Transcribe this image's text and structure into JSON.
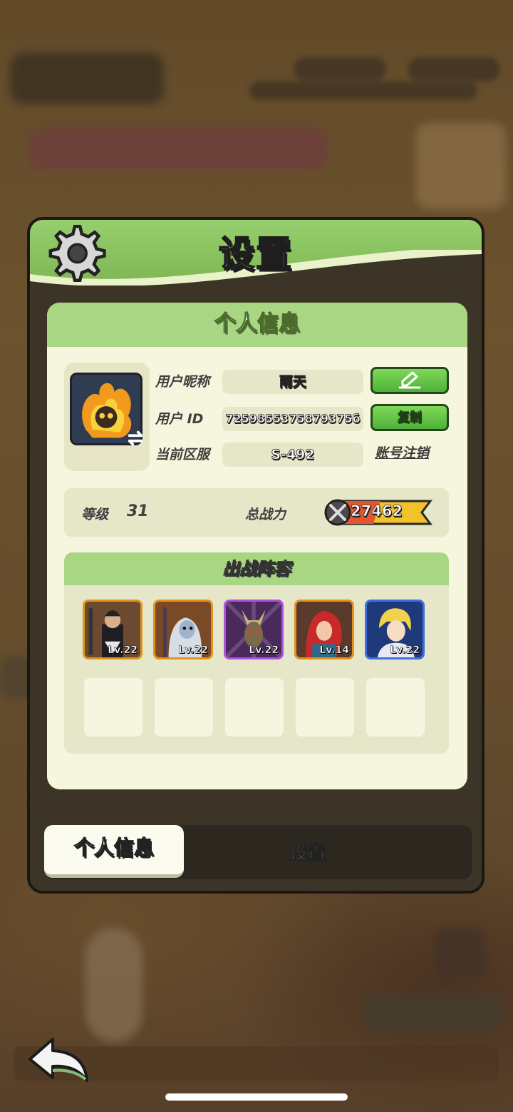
{
  "dialog": {
    "title": "设置",
    "card_title": "个人信息",
    "fields": {
      "nickname_label": "用户昵称",
      "nickname_value": "雨天",
      "userid_label": "用户  ID",
      "userid_value": "7259855375879375б",
      "server_label": "当前区服",
      "server_value": "S-492"
    },
    "buttons": {
      "edit_icon": "pencil-icon",
      "copy_label": "复制",
      "cancel_account_label": "账号注销"
    },
    "stats": {
      "level_label": "等级",
      "level_value": "31",
      "power_label": "总战力",
      "power_value": "27462"
    },
    "lineup": {
      "title": "出战阵容",
      "heroes": [
        {
          "level": "Lv.22",
          "frame": "#e0941e"
        },
        {
          "level": "Lv.22",
          "frame": "#e0941e"
        },
        {
          "level": "Lv.22",
          "frame": "#b14fe0"
        },
        {
          "level": "Lv.14",
          "frame": "#e0941e"
        },
        {
          "level": "Lv.22",
          "frame": "#3f6fe0"
        }
      ],
      "empty_slots": 5
    },
    "tabs": {
      "active": "个人信息",
      "inactive": "设置"
    }
  },
  "colors": {
    "header_green": "#8cc462",
    "card_bg": "#f6f6de",
    "button_green": "#5fc145",
    "panel_dark": "#3c3527"
  }
}
